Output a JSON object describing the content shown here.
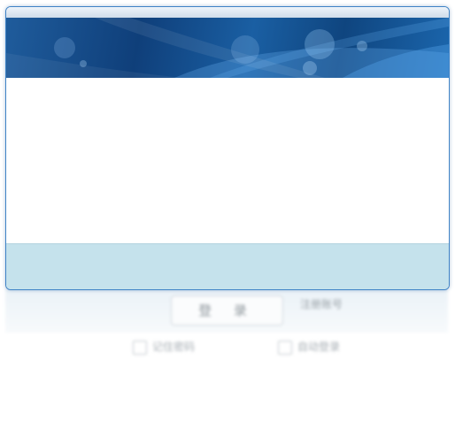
{
  "window": {
    "title": "",
    "colors": {
      "border": "#3f83c6",
      "banner_dark": "#0f3f7a",
      "banner_light": "#1b66ad",
      "footer": "#c5e2ec"
    }
  },
  "background_form": {
    "login_button_label": "登 录",
    "register_link_label": "注册账号",
    "remember_password_label": "记住密码",
    "auto_login_label": "自动登录"
  }
}
